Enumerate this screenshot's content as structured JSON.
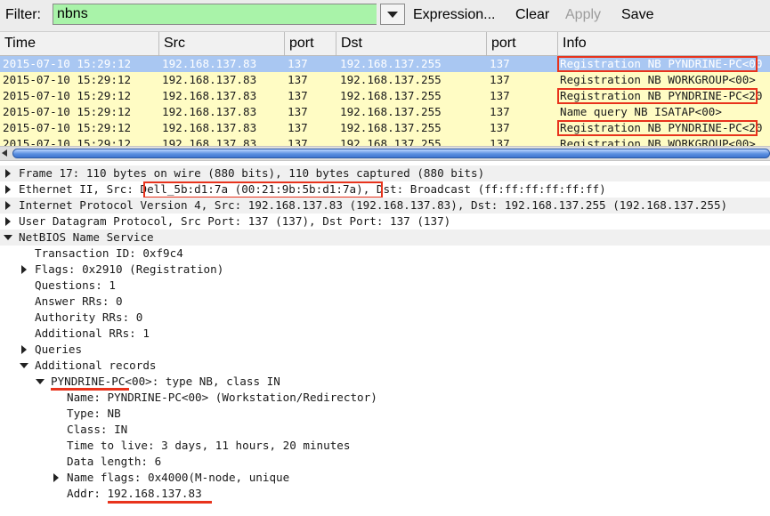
{
  "filter": {
    "label": "Filter:",
    "value": "nbns",
    "buttons": {
      "expression": "Expression...",
      "clear": "Clear",
      "apply": "Apply",
      "save": "Save"
    }
  },
  "packet_list": {
    "columns": {
      "time": "Time",
      "src": "Src",
      "src_port": "port",
      "dst": "Dst",
      "dst_port": "port",
      "info": "Info"
    },
    "rows": [
      {
        "time": "2015-07-10 15:29:12",
        "src": "192.168.137.83",
        "src_port": "137",
        "dst": "192.168.137.255",
        "dst_port": "137",
        "info": "Registration NB PYNDRINE-PC<00"
      },
      {
        "time": "2015-07-10 15:29:12",
        "src": "192.168.137.83",
        "src_port": "137",
        "dst": "192.168.137.255",
        "dst_port": "137",
        "info": "Registration NB WORKGROUP<00>"
      },
      {
        "time": "2015-07-10 15:29:12",
        "src": "192.168.137.83",
        "src_port": "137",
        "dst": "192.168.137.255",
        "dst_port": "137",
        "info": "Registration NB PYNDRINE-PC<20"
      },
      {
        "time": "2015-07-10 15:29:12",
        "src": "192.168.137.83",
        "src_port": "137",
        "dst": "192.168.137.255",
        "dst_port": "137",
        "info": "Name query NB ISATAP<00>"
      },
      {
        "time": "2015-07-10 15:29:12",
        "src": "192.168.137.83",
        "src_port": "137",
        "dst": "192.168.137.255",
        "dst_port": "137",
        "info": "Registration NB PYNDRINE-PC<20"
      },
      {
        "time": "2015-07-10 15:29:12",
        "src": "192.168.137.83",
        "src_port": "137",
        "dst": "192.168.137.255",
        "dst_port": "137",
        "info": "Registration NB WORKGROUP<00>"
      }
    ]
  },
  "details": {
    "frame": "Frame 17: 110 bytes on wire (880 bits), 110 bytes captured (880 bits)",
    "ethernet": {
      "prefix": "Ethernet II, Src: ",
      "src": "Dell_5b:d1:7a (00:21:9b:5b:d1:7a)",
      "suffix": ", Dst: Broadcast (ff:ff:ff:ff:ff:ff)"
    },
    "ip": "Internet Protocol Version 4, Src: 192.168.137.83 (192.168.137.83), Dst: 192.168.137.255 (192.168.137.255)",
    "udp": "User Datagram Protocol, Src Port: 137 (137), Dst Port: 137 (137)",
    "nbns": "NetBIOS Name Service",
    "nbns_fields": {
      "transaction_id": "Transaction ID: 0xf9c4",
      "flags": "Flags: 0x2910 (Registration)",
      "questions": "Questions: 1",
      "answer_rrs": "Answer RRs: 0",
      "authority_rrs": "Authority RRs: 0",
      "additional_rrs": "Additional RRs: 1",
      "queries": "Queries",
      "additional_records": "Additional records"
    },
    "record": {
      "name": "PYNDRINE-PC",
      "suffix": "<00>: type NB, class IN"
    },
    "record_fields": {
      "name": "Name: PYNDRINE-PC<00> (Workstation/Redirector)",
      "type": "Type: NB",
      "class": "Class: IN",
      "ttl": "Time to live: 3 days, 11 hours, 20 minutes",
      "data_length": "Data length: 6",
      "name_flags": "Name flags: 0x4000(M-node, unique",
      "addr_label": "Addr: ",
      "addr_value": "192.168.137.83"
    }
  },
  "colors": {
    "filter_ok": "#a9f3a9",
    "row_yellow": "#fffcc4",
    "row_selected": "#a9c7f2",
    "highlight_red": "#e8331c"
  }
}
